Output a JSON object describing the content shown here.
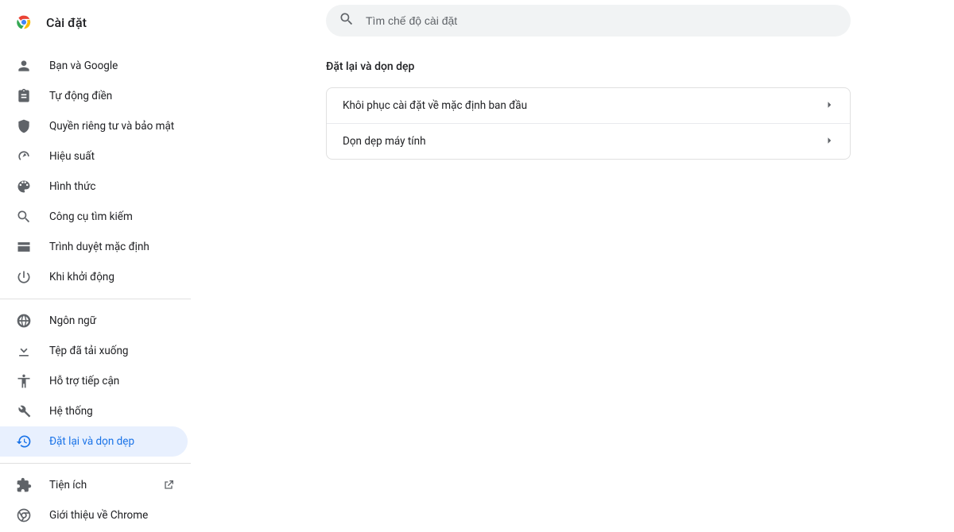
{
  "header": {
    "title": "Cài đặt"
  },
  "search": {
    "placeholder": "Tìm chế độ cài đặt"
  },
  "sidebar": {
    "groups": [
      [
        {
          "icon": "person",
          "label": "Bạn và Google"
        },
        {
          "icon": "assignment",
          "label": "Tự động điền"
        },
        {
          "icon": "shield",
          "label": "Quyền riêng tư và bảo mật"
        },
        {
          "icon": "speed",
          "label": "Hiệu suất"
        },
        {
          "icon": "palette",
          "label": "Hình thức"
        },
        {
          "icon": "search",
          "label": "Công cụ tìm kiếm"
        },
        {
          "icon": "browser",
          "label": "Trình duyệt mặc định"
        },
        {
          "icon": "power",
          "label": "Khi khởi động"
        }
      ],
      [
        {
          "icon": "globe",
          "label": "Ngôn ngữ"
        },
        {
          "icon": "download",
          "label": "Tệp đã tải xuống"
        },
        {
          "icon": "accessibility",
          "label": "Hỗ trợ tiếp cận"
        },
        {
          "icon": "wrench",
          "label": "Hệ thống"
        },
        {
          "icon": "restore",
          "label": "Đặt lại và dọn dẹp",
          "selected": true
        }
      ],
      [
        {
          "icon": "extension",
          "label": "Tiện ích",
          "external": true
        },
        {
          "icon": "chrome",
          "label": "Giới thiệu về Chrome"
        }
      ]
    ]
  },
  "main": {
    "section_title": "Đặt lại và dọn dẹp",
    "rows": [
      {
        "label": "Khôi phục cài đặt về mặc định ban đầu"
      },
      {
        "label": "Dọn dẹp máy tính"
      }
    ]
  }
}
